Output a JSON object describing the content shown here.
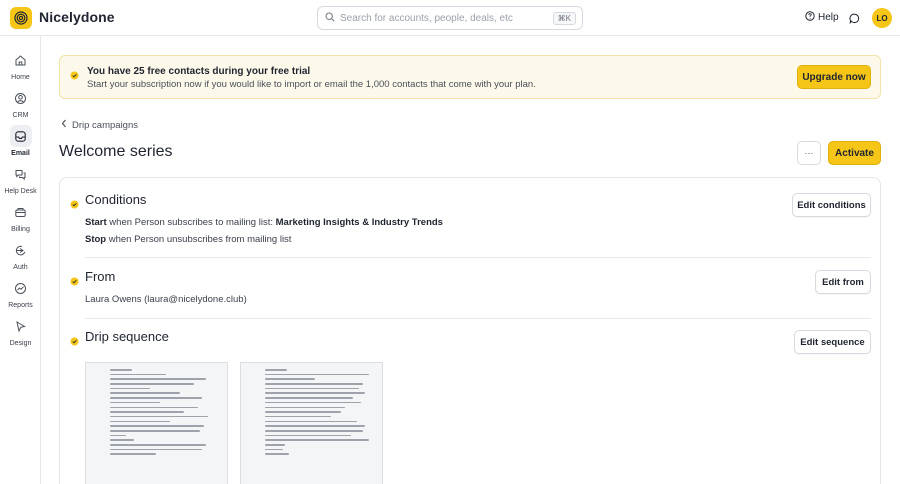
{
  "app": {
    "brand": "Nicelydone",
    "logo_icon": "spiral-logo-icon",
    "accent_color": "#f5c518"
  },
  "header": {
    "search_placeholder": "Search for accounts, people, deals, etc",
    "search_shortcut": "⌘K",
    "help_label": "Help",
    "avatar_initials": "LO"
  },
  "sidebar": {
    "items": [
      {
        "label": "Home",
        "icon": "home-icon"
      },
      {
        "label": "CRM",
        "icon": "crm-icon"
      },
      {
        "label": "Email",
        "icon": "mail-icon",
        "active": true
      },
      {
        "label": "Help Desk",
        "icon": "help-desk-icon"
      },
      {
        "label": "Billing",
        "icon": "billing-icon"
      },
      {
        "label": "Auth",
        "icon": "auth-icon"
      },
      {
        "label": "Reports",
        "icon": "reports-icon"
      },
      {
        "label": "Design",
        "icon": "design-icon"
      }
    ]
  },
  "banner": {
    "title": "You have 25 free contacts during your free trial",
    "subtitle": "Start your subscription now if you would like to import or email the 1,000 contacts that come with your plan.",
    "upgrade_label": "Upgrade now"
  },
  "page": {
    "breadcrumb": "Drip campaigns",
    "title": "Welcome series",
    "more_label": "···",
    "activate_label": "Activate"
  },
  "conditions": {
    "title": "Conditions",
    "start_keyword": "Start",
    "start_text": " when Person subscribes to mailing list: ",
    "start_list": "Marketing Insights & Industry Trends",
    "stop_keyword": "Stop",
    "stop_text": " when Person unsubscribes from mailing list",
    "edit_label": "Edit conditions"
  },
  "from": {
    "title": "From",
    "sender": "Laura Owens (laura@nicelydone.club)",
    "edit_label": "Edit from"
  },
  "drip": {
    "title": "Drip sequence",
    "edit_label": "Edit sequence"
  }
}
